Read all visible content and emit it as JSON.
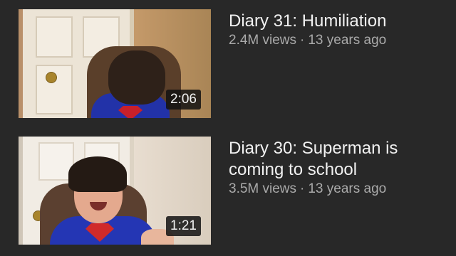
{
  "videos": [
    {
      "title": "Diary 31: Humiliation",
      "views": "2.4M views",
      "separator": "·",
      "age": "13 years ago",
      "duration": "2:06"
    },
    {
      "title": "Diary 30: Superman is coming to school",
      "views": "3.5M views",
      "separator": "·",
      "age": "13 years ago",
      "duration": "1:21"
    }
  ],
  "colors": {
    "background": "#282828",
    "title_text": "#f1f1f1",
    "meta_text": "#aaaaaa",
    "duration_badge": "#121212"
  }
}
